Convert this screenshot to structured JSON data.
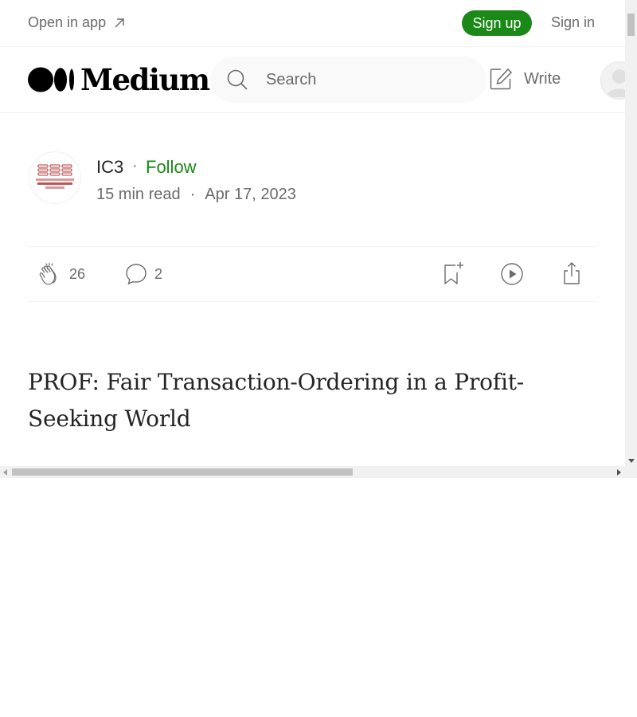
{
  "topbar": {
    "open_in_app": "Open in app",
    "open_in_app_icon": "arrow-up-right-icon",
    "sign_up": "Sign up",
    "sign_in": "Sign in"
  },
  "header": {
    "logo_text": "Medium",
    "search_placeholder": "Search",
    "write_label": "Write"
  },
  "author": {
    "name": "IC3",
    "separator": "·",
    "follow_label": "Follow",
    "read_time": "15 min read",
    "meta_separator": "·",
    "date": "Apr 17, 2023",
    "avatar_logo_lines": [
      "The Initiative for",
      "CryptoCurrencies",
      "and Contracts"
    ]
  },
  "actions": {
    "claps": "26",
    "comments": "2",
    "icons": [
      "clap-icon",
      "comment-icon",
      "bookmark-add-icon",
      "play-icon",
      "share-icon"
    ]
  },
  "article": {
    "title": "PROF: Fair Transaction-Ordering in a Profit-Seeking World"
  },
  "colors": {
    "brand_green": "#1a8917",
    "text": "#242424",
    "muted": "#6b6b6b",
    "ic3_red": "#b03a3a"
  }
}
